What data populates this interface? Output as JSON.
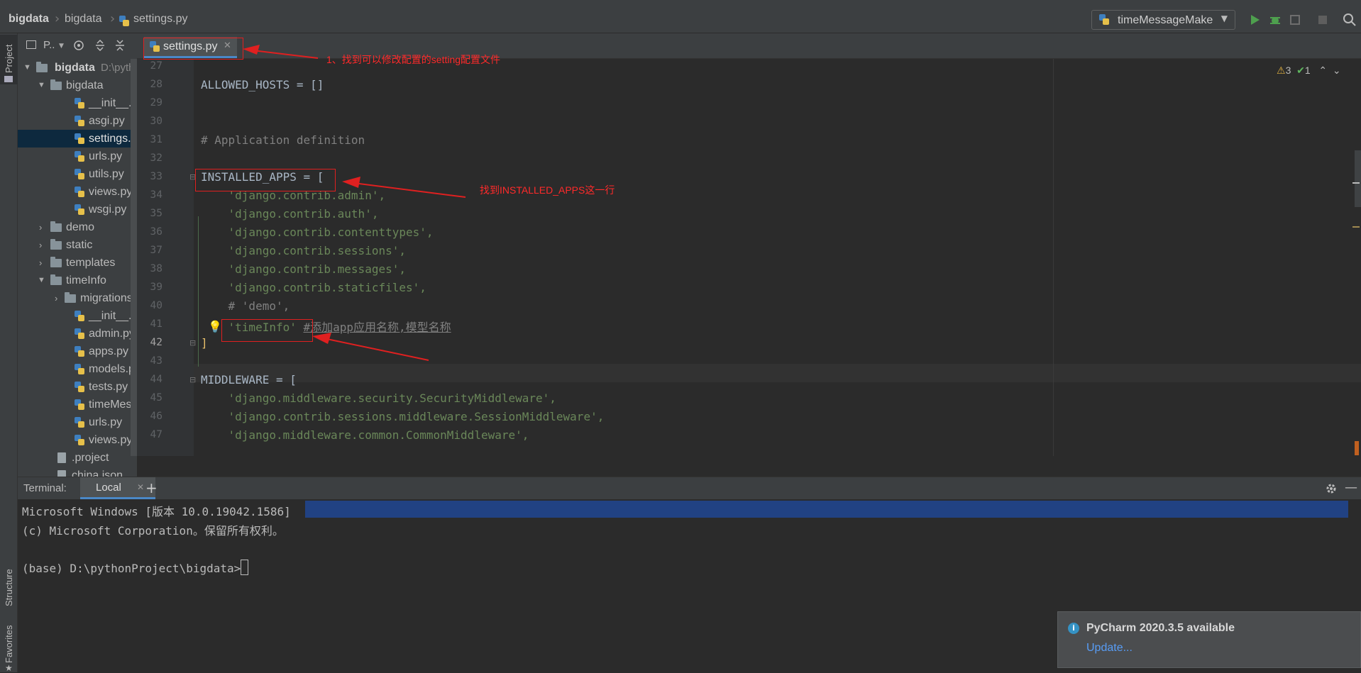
{
  "breadcrumb": [
    "bigdata",
    "bigdata",
    "settings.py"
  ],
  "run_config": {
    "label": "timeMessageMake"
  },
  "left_strip": {
    "project": "Project",
    "structure": "Structure",
    "favorites": "Favorites"
  },
  "project_panel": {
    "header": "P..",
    "tree": [
      {
        "label": "bigdata",
        "hint": "D:\\pyth",
        "type": "folder",
        "level": 0,
        "expanded": true
      },
      {
        "label": "bigdata",
        "type": "folder",
        "level": 1,
        "expanded": true
      },
      {
        "label": "__init__.py",
        "type": "py",
        "level": 2
      },
      {
        "label": "asgi.py",
        "type": "py",
        "level": 2
      },
      {
        "label": "settings.py",
        "type": "py",
        "level": 2,
        "selected": true
      },
      {
        "label": "urls.py",
        "type": "py",
        "level": 2
      },
      {
        "label": "utils.py",
        "type": "py",
        "level": 2
      },
      {
        "label": "views.py",
        "type": "py",
        "level": 2
      },
      {
        "label": "wsgi.py",
        "type": "py",
        "level": 2
      },
      {
        "label": "demo",
        "type": "folder",
        "level": 1,
        "expanded": false
      },
      {
        "label": "static",
        "type": "folder",
        "level": 1,
        "expanded": false
      },
      {
        "label": "templates",
        "type": "folder",
        "level": 1,
        "expanded": false
      },
      {
        "label": "timeInfo",
        "type": "folder",
        "level": 1,
        "expanded": true
      },
      {
        "label": "migrations",
        "type": "folder",
        "level": 2,
        "expanded": false
      },
      {
        "label": "__init__.py",
        "type": "py",
        "level": 2
      },
      {
        "label": "admin.py",
        "type": "py",
        "level": 2
      },
      {
        "label": "apps.py",
        "type": "py",
        "level": 2
      },
      {
        "label": "models.py",
        "type": "py",
        "level": 2
      },
      {
        "label": "tests.py",
        "type": "py",
        "level": 2
      },
      {
        "label": "timeMessageMake.py",
        "type": "py",
        "level": 2
      },
      {
        "label": "urls.py",
        "type": "py",
        "level": 2
      },
      {
        "label": "views.py",
        "type": "py",
        "level": 2
      },
      {
        "label": ".project",
        "type": "file",
        "level": 1
      },
      {
        "label": "china.json",
        "type": "file",
        "level": 1
      }
    ]
  },
  "editor": {
    "tab": "settings.py",
    "inspections": {
      "warnings": "3",
      "typos": "1"
    },
    "lines": [
      {
        "n": "27",
        "code": ""
      },
      {
        "n": "28",
        "code": "ALLOWED_HOSTS = []"
      },
      {
        "n": "29",
        "code": ""
      },
      {
        "n": "30",
        "code": ""
      },
      {
        "n": "31",
        "code": "# Application definition"
      },
      {
        "n": "32",
        "code": ""
      },
      {
        "n": "33",
        "code": "INSTALLED_APPS = ["
      },
      {
        "n": "34",
        "code": "    'django.contrib.admin',"
      },
      {
        "n": "35",
        "code": "    'django.contrib.auth',"
      },
      {
        "n": "36",
        "code": "    'django.contrib.contenttypes',"
      },
      {
        "n": "37",
        "code": "    'django.contrib.sessions',"
      },
      {
        "n": "38",
        "code": "    'django.contrib.messages',"
      },
      {
        "n": "39",
        "code": "    'django.contrib.staticfiles',"
      },
      {
        "n": "40",
        "code": "    # 'demo',"
      },
      {
        "n": "41",
        "code": "    'timeInfo' #添加app应用名称,模型名称"
      },
      {
        "n": "42",
        "code": "]"
      },
      {
        "n": "43",
        "code": ""
      },
      {
        "n": "44",
        "code": "MIDDLEWARE = ["
      },
      {
        "n": "45",
        "code": "    'django.middleware.security.SecurityMiddleware',"
      },
      {
        "n": "46",
        "code": "    'django.contrib.sessions.middleware.SessionMiddleware',"
      },
      {
        "n": "47",
        "code": "    'django.middleware.common.CommonMiddleware',"
      }
    ]
  },
  "annotations": {
    "a1": "1、找到可以修改配置的setting配置文件",
    "a2": "找到INSTALLED_APPS这一行"
  },
  "terminal": {
    "title": "Terminal:",
    "tab": "Local",
    "lines": [
      "Microsoft Windows [版本 10.0.19042.1586]",
      "(c) Microsoft Corporation。保留所有权利。",
      "",
      "(base) D:\\pythonProject\\bigdata>"
    ]
  },
  "notification": {
    "title": "PyCharm 2020.3.5 available",
    "link": "Update..."
  }
}
